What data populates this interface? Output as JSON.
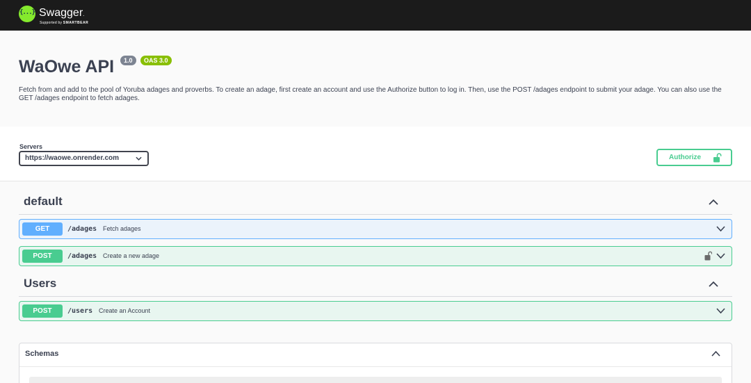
{
  "topbar": {
    "logo_glyph": "{...}",
    "name": "Swagger",
    "tm": ".",
    "supported_prefix": "Supported by",
    "supported_brand": "SMARTBEAR",
    "logo_color": "#85ea2d",
    "bg_color": "#1b1b1b"
  },
  "info": {
    "title": "WaOwe API",
    "version_badge": "1.0",
    "oas_badge": "OAS 3.0",
    "description": "Fetch from and add to the pool of Yoruba adages and proverbs. To create an adage, first create an account and use the Authorize button to log in. Then, use the POST /adages endpoint to submit your adage. You can also use the GET /adages endpoint to fetch adages."
  },
  "servers": {
    "label": "Servers",
    "selected": "https://waowe.onrender.com"
  },
  "authorize": {
    "label": "Authorize",
    "icon": "unlocked-lock-icon"
  },
  "tags": [
    {
      "name": "default",
      "operations": [
        {
          "method": "GET",
          "path": "/adages",
          "summary": "Fetch adages",
          "locked": false
        },
        {
          "method": "POST",
          "path": "/adages",
          "summary": "Create a new adage",
          "locked": true
        }
      ]
    },
    {
      "name": "Users",
      "operations": [
        {
          "method": "POST",
          "path": "/users",
          "summary": "Create an Account",
          "locked": false
        }
      ]
    }
  ],
  "schemas": {
    "title": "Schemas"
  },
  "colors": {
    "get": "#61affe",
    "post": "#49cc90",
    "oas_badge": "#89bf04",
    "version_badge": "#7d8492"
  }
}
